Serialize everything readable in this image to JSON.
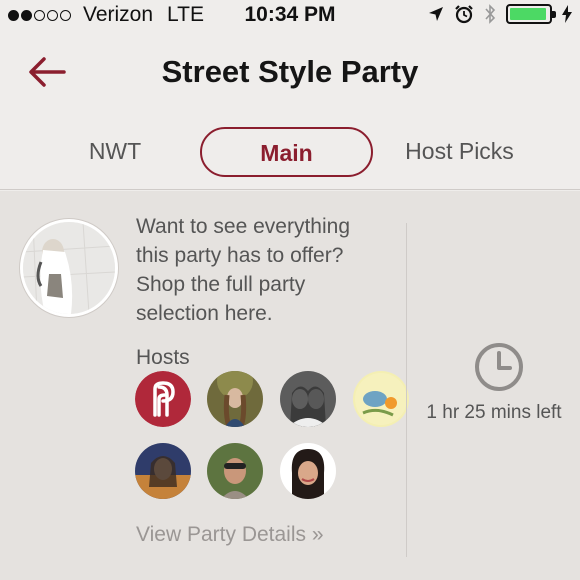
{
  "status_bar": {
    "carrier": "Verizon",
    "network": "LTE",
    "time": "10:34 PM",
    "signal_bars": 2,
    "signal_total": 5,
    "battery_level": 0.95,
    "battery_color": "#4cd964",
    "icons": [
      "location-arrow-icon",
      "alarm-clock-icon",
      "bluetooth-icon",
      "battery-icon",
      "charging-bolt-icon"
    ]
  },
  "header": {
    "title": "Street Style Party",
    "back_icon": "back-arrow-icon",
    "accent_color": "#8b1e2e"
  },
  "tabs": [
    {
      "label": "NWT",
      "selected": false
    },
    {
      "label": "Main",
      "selected": true
    },
    {
      "label": "Host Picks",
      "selected": false
    }
  ],
  "party": {
    "description": "Want to see everything this party has to offer? Shop the full party selection here.",
    "hosts_label": "Hosts",
    "hosts": [
      {
        "name": "host-1",
        "type": "poshmark-logo"
      },
      {
        "name": "host-2",
        "type": "photo"
      },
      {
        "name": "host-3",
        "type": "photo"
      },
      {
        "name": "host-4",
        "type": "illustration"
      },
      {
        "name": "host-5",
        "type": "photo"
      },
      {
        "name": "host-6",
        "type": "photo"
      },
      {
        "name": "host-7",
        "type": "photo"
      }
    ],
    "view_details": "View Party Details »",
    "time_left": "1 hr 25 mins left",
    "clock_icon": "clock-icon"
  }
}
